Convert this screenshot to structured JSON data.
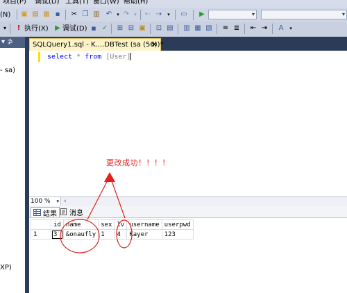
{
  "menu": {
    "items": [
      "项目(P)",
      "调试(D)",
      "工具(T)",
      "窗口(W)",
      "帮助(H)"
    ]
  },
  "toolbar": {
    "new_query_label": "(N)",
    "execute_label": "执行(X)",
    "debug_label": "调试(D)"
  },
  "left_panel": {
    "header_pin": "▾ ⊅",
    "connection_text": "- sa)",
    "bottom_text": "XP)"
  },
  "editor": {
    "tab_title": "SQLQuery1.sql - K....DBTest (sa (56))*",
    "tab_close": "×",
    "code": {
      "kw1": "select",
      "star": "*",
      "kw2": "from",
      "table": "[User]"
    },
    "annotation": "更改成功！！！！"
  },
  "zoom": {
    "value": "100 %"
  },
  "results": {
    "tabs": [
      "结果",
      "消息"
    ],
    "columns": [
      "id",
      "name",
      "sex",
      "lv",
      "username",
      "userpwd"
    ],
    "rows": [
      {
        "num": "1",
        "id": "3",
        "name": "&onaufly",
        "sex": "1",
        "lv": "4",
        "username": "Kayer",
        "userpwd": "123"
      }
    ]
  },
  "colors": {
    "annotation": "#e3201b",
    "tab_active": "#fdf3c9",
    "frame": "#2b3c59"
  }
}
